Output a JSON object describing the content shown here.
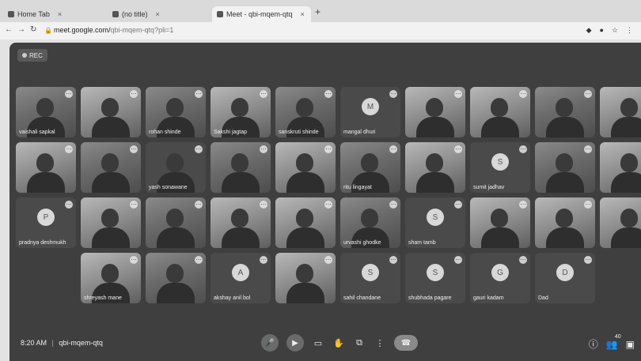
{
  "tabs": [
    {
      "label": "Home Tab",
      "active": false
    },
    {
      "label": "(no title)",
      "active": false
    },
    {
      "label": "Meet - qbi-mqem-qtq",
      "active": true
    }
  ],
  "address": {
    "host": "meet.google.com/",
    "path": "qbi-mqem-qtq?pli=1"
  },
  "recording": {
    "label": "REC"
  },
  "tiles": [
    {
      "name": "vaishali sapkal",
      "kind": "photo"
    },
    {
      "name": "",
      "kind": "light"
    },
    {
      "name": "rohan shinde",
      "kind": "photo"
    },
    {
      "name": "Sakshi jagtap",
      "kind": "light"
    },
    {
      "name": "sanskruti shinde",
      "kind": "photo"
    },
    {
      "name": "mangal dhuri",
      "kind": "avatar",
      "initial": "M"
    },
    {
      "name": "",
      "kind": "light"
    },
    {
      "name": "",
      "kind": "light"
    },
    {
      "name": "",
      "kind": "photo"
    },
    {
      "name": "",
      "kind": "light"
    },
    {
      "name": "",
      "kind": "light"
    },
    {
      "name": "",
      "kind": "photo"
    },
    {
      "name": "yash sonawane",
      "kind": "dark"
    },
    {
      "name": "",
      "kind": "photo"
    },
    {
      "name": "",
      "kind": "light"
    },
    {
      "name": "ritu lingayat",
      "kind": "photo"
    },
    {
      "name": "",
      "kind": "light"
    },
    {
      "name": "sumit jadhav",
      "kind": "avatar",
      "initial": "S"
    },
    {
      "name": "",
      "kind": "photo"
    },
    {
      "name": "",
      "kind": "light"
    },
    {
      "name": "pradnya deshmukh",
      "kind": "avatar",
      "initial": "P"
    },
    {
      "name": "",
      "kind": "light"
    },
    {
      "name": "",
      "kind": "photo"
    },
    {
      "name": "",
      "kind": "light"
    },
    {
      "name": "",
      "kind": "light"
    },
    {
      "name": "urvashi ghodke",
      "kind": "photo"
    },
    {
      "name": "sham tamb",
      "kind": "avatar",
      "initial": "S"
    },
    {
      "name": "",
      "kind": "light"
    },
    {
      "name": "",
      "kind": "light"
    },
    {
      "name": "",
      "kind": "light"
    },
    {
      "name": "",
      "kind": "empty"
    },
    {
      "name": "shreyash mane",
      "kind": "light"
    },
    {
      "name": "",
      "kind": "photo"
    },
    {
      "name": "akshay anil bol",
      "kind": "avatar",
      "initial": "A"
    },
    {
      "name": "",
      "kind": "light"
    },
    {
      "name": "sahil chandane",
      "kind": "avatar",
      "initial": "S"
    },
    {
      "name": "shubhada pagare",
      "kind": "avatar",
      "initial": "S"
    },
    {
      "name": "gauri kadam",
      "kind": "avatar",
      "initial": "G"
    },
    {
      "name": "Dad",
      "kind": "avatar",
      "initial": "D"
    },
    {
      "name": "",
      "kind": "empty"
    }
  ],
  "bottom": {
    "time": "8:20 AM",
    "code": "qbi-mqem-qtq"
  },
  "participants_count": "40"
}
